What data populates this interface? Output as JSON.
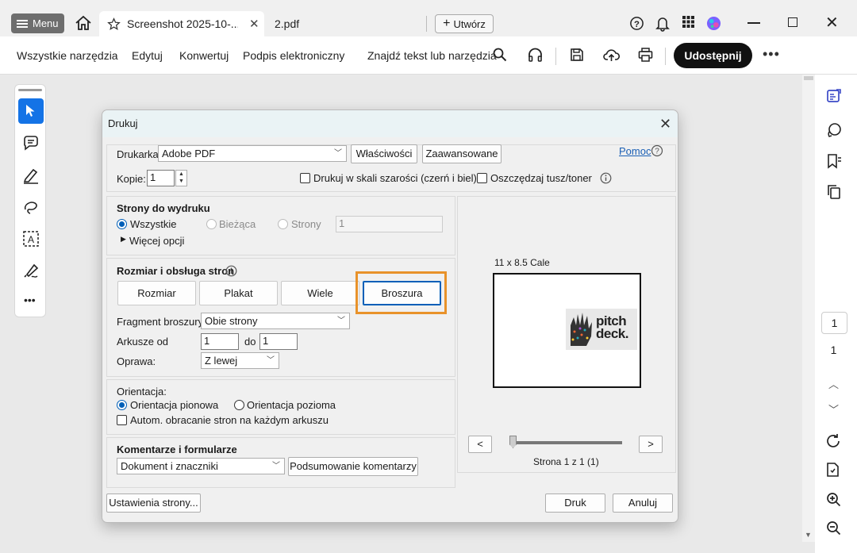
{
  "titlebar": {
    "menu_label": "Menu",
    "active_tab": "Screenshot 2025-10-...",
    "second_tab": "2.pdf",
    "new_button": "Utwórz"
  },
  "toolbar": {
    "items": [
      "Wszystkie narzędzia",
      "Edytuj",
      "Konwertuj",
      "Podpis elektroniczny"
    ],
    "search_placeholder": "Znajdź tekst lub narzędzia",
    "share_label": "Udostępnij"
  },
  "right_panel": {
    "page_current": "1",
    "page_total": "1"
  },
  "dialog": {
    "title": "Drukuj",
    "printer_label": "Drukarka:",
    "printer_value": "Adobe PDF",
    "properties_button": "Właściwości",
    "advanced_button": "Zaawansowane",
    "help_link": "Pomoc",
    "copies_label": "Kopie:",
    "copies_value": "1",
    "grayscale_label": "Drukuj w skali szarości (czerń i biel)",
    "save_ink_label": "Oszczędzaj tusz/toner",
    "pages_section": {
      "title": "Strony do wydruku",
      "all": "Wszystkie",
      "current": "Bieżąca",
      "pages": "Strony",
      "pages_value": "1",
      "more_options": "Więcej opcji"
    },
    "size_section": {
      "title": "Rozmiar i obsługa stron",
      "buttons": [
        "Rozmiar",
        "Plakat",
        "Wiele",
        "Broszura"
      ],
      "selected": "Broszura",
      "fragment_label": "Fragment broszury:",
      "fragment_value": "Obie strony",
      "sheets_label": "Arkusze od",
      "sheets_from": "1",
      "sheets_to_label": "do",
      "sheets_to": "1",
      "binding_label": "Oprawa:",
      "binding_value": "Z lewej"
    },
    "orientation_section": {
      "title": "Orientacja:",
      "portrait": "Orientacja pionowa",
      "landscape": "Orientacja pozioma",
      "auto_rotate": "Autom. obracanie stron na każdym arkuszu"
    },
    "comments_section": {
      "title": "Komentarze i formularze",
      "value": "Dokument i znaczniki",
      "summary_button": "Podsumowanie komentarzy"
    },
    "preview": {
      "paper_size": "11 x 8.5 Cale",
      "logo_line1": "pitch",
      "logo_line2": "deck.",
      "prev": "<",
      "next": ">",
      "page_info": "Strona 1 z 1 (1)"
    },
    "page_setup_button": "Ustawienia strony...",
    "print_button": "Druk",
    "cancel_button": "Anuluj"
  }
}
